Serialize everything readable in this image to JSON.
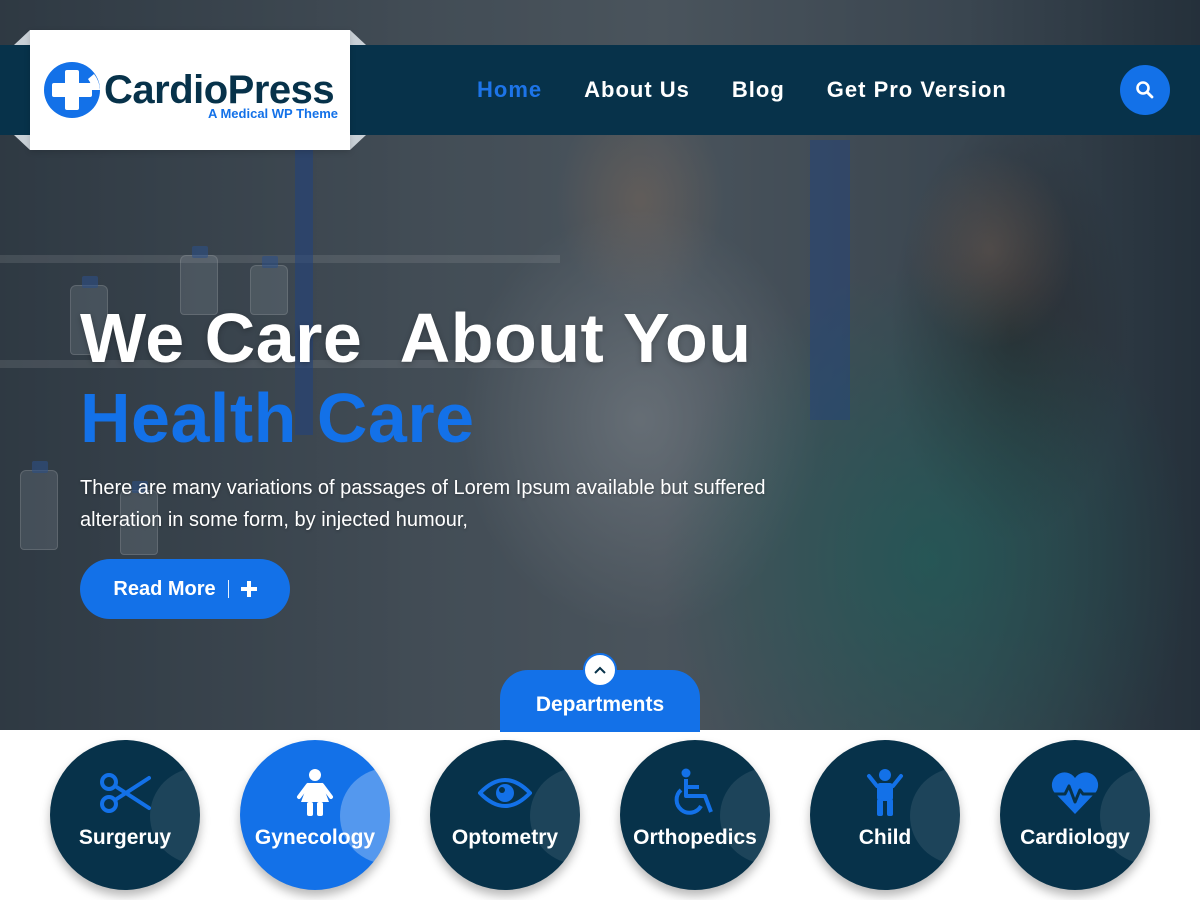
{
  "brand": {
    "name": "CardioPress",
    "tagline": "A Medical WP Theme",
    "logo_icon": "medical-cross-icon"
  },
  "nav": {
    "items": [
      {
        "label": "Home",
        "active": true
      },
      {
        "label": "About Us",
        "active": false
      },
      {
        "label": "Blog",
        "active": false
      },
      {
        "label": "Get Pro Version",
        "active": false
      }
    ],
    "search_icon": "search-icon"
  },
  "hero": {
    "title_line1": "We Care  About You",
    "title_line2": "Health Care",
    "description": "There are many variations of passages of Lorem Ipsum available but suffered alteration in some form, by injected humour,",
    "cta_label": "Read More",
    "cta_icon": "plus-icon"
  },
  "departments": {
    "tab_label": "Departments",
    "toggle_icon": "chevron-up-icon",
    "items": [
      {
        "label": "Surgeruy",
        "icon": "scissors-icon",
        "active": false
      },
      {
        "label": "Gynecology",
        "icon": "female-icon",
        "active": true
      },
      {
        "label": "Optometry",
        "icon": "eye-icon",
        "active": false
      },
      {
        "label": "Orthopedics",
        "icon": "wheelchair-icon",
        "active": false
      },
      {
        "label": "Child",
        "icon": "child-icon",
        "active": false
      },
      {
        "label": "Cardiology",
        "icon": "heartbeat-icon",
        "active": false
      }
    ]
  },
  "colors": {
    "navy": "#07324a",
    "accent": "#1371e8",
    "white": "#ffffff"
  }
}
